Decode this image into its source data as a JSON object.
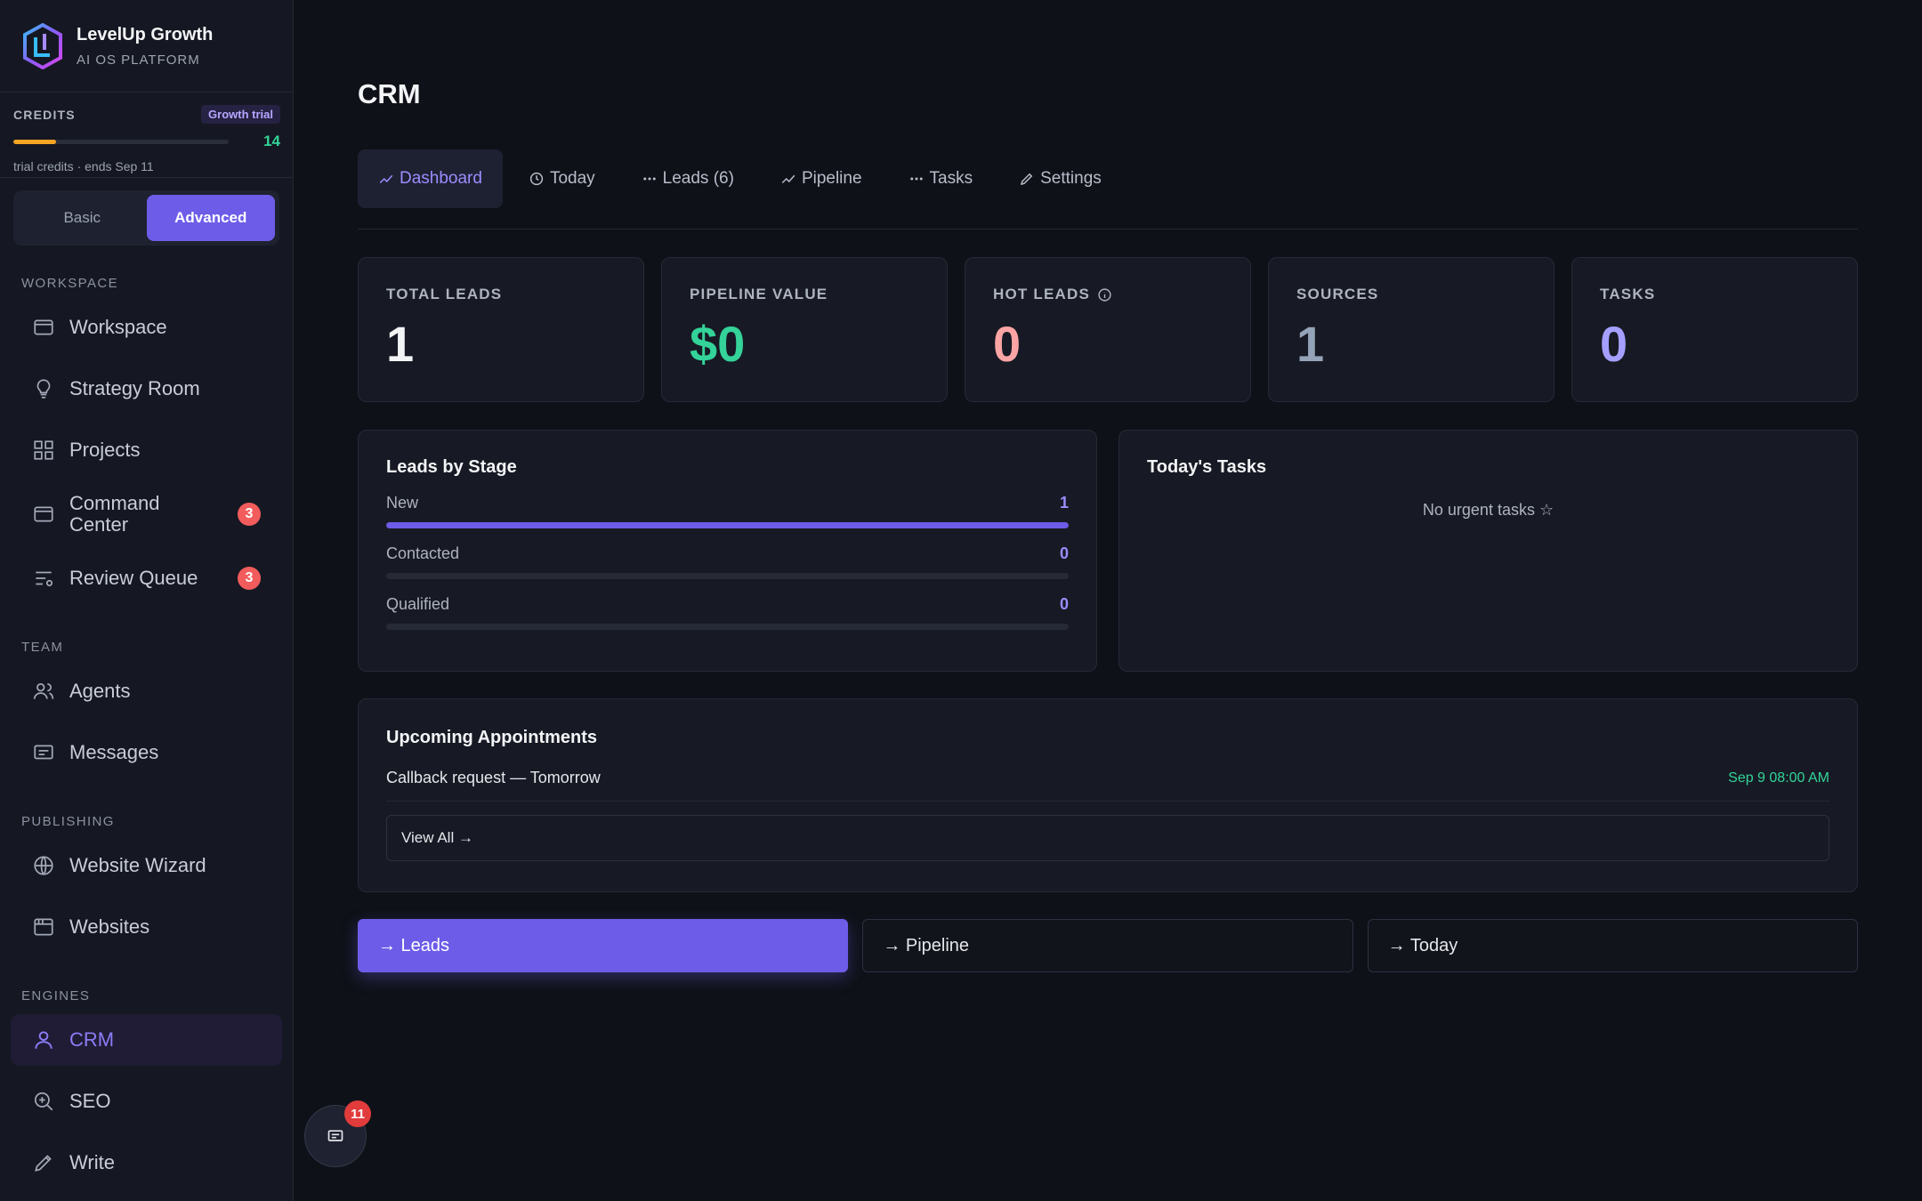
{
  "brand": {
    "name": "LevelUp Growth",
    "subtitle": "AI OS PLATFORM"
  },
  "credits": {
    "label": "CREDITS",
    "badge": "Growth trial",
    "count": "14",
    "fill_fraction": 0.2,
    "note": "trial credits · ends Sep 11"
  },
  "mode": {
    "basic": "Basic",
    "advanced": "Advanced",
    "selected": "Advanced"
  },
  "sidebar": {
    "workspace_label": "WORKSPACE",
    "workspace": [
      {
        "label": "Workspace",
        "icon": "window-icon"
      },
      {
        "label": "Strategy Room",
        "icon": "lightbulb-icon"
      },
      {
        "label": "Projects",
        "icon": "grid-icon"
      },
      {
        "label": "Command Center",
        "icon": "window-icon",
        "badge": "3"
      },
      {
        "label": "Review Queue",
        "icon": "list-filter-icon",
        "badge": "3"
      }
    ],
    "team_label": "TEAM",
    "team": [
      {
        "label": "Agents",
        "icon": "users-icon"
      },
      {
        "label": "Messages",
        "icon": "message-icon"
      }
    ],
    "publishing_label": "PUBLISHING",
    "publishing": [
      {
        "label": "Website Wizard",
        "icon": "globe-icon"
      },
      {
        "label": "Websites",
        "icon": "browser-icon"
      }
    ],
    "engines_label": "ENGINES",
    "engines": [
      {
        "label": "CRM",
        "icon": "user-icon",
        "active": true
      },
      {
        "label": "SEO",
        "icon": "search-plus-icon"
      },
      {
        "label": "Write",
        "icon": "pencil-icon"
      }
    ]
  },
  "page": {
    "title": "CRM"
  },
  "tabs": [
    {
      "label": "Dashboard",
      "icon": "trend-icon"
    },
    {
      "label": "Today",
      "icon": "clock-icon"
    },
    {
      "label": "Leads (6)",
      "icon": "dots-icon"
    },
    {
      "label": "Pipeline",
      "icon": "trend-icon"
    },
    {
      "label": "Tasks",
      "icon": "dots-icon"
    },
    {
      "label": "Settings",
      "icon": "pencil-icon"
    }
  ],
  "stats": [
    {
      "label": "TOTAL LEADS",
      "value": "1",
      "color": "#f3f4f6"
    },
    {
      "label": "PIPELINE VALUE",
      "value": "$0",
      "color": "#34d399"
    },
    {
      "label": "HOT LEADS",
      "value": "0",
      "color": "#fca5a5"
    },
    {
      "label": "SOURCES",
      "value": "1",
      "color": "#94a3b8"
    },
    {
      "label": "TASKS",
      "value": "0",
      "color": "#a5a0ff"
    }
  ],
  "leads_by_stage": {
    "title": "Leads by Stage",
    "stages": [
      {
        "name": "New",
        "count": "1",
        "fraction": 1
      },
      {
        "name": "Contacted",
        "count": "0",
        "fraction": 0
      },
      {
        "name": "Qualified",
        "count": "0",
        "fraction": 0
      }
    ]
  },
  "todays_tasks": {
    "title": "Today's Tasks",
    "empty": "No urgent tasks ☆"
  },
  "appointments": {
    "title": "Upcoming Appointments",
    "items": [
      {
        "title": "Callback request — Tomorrow",
        "time": "Sep 9 08:00 AM"
      }
    ],
    "view_all": "View All →"
  },
  "actions": {
    "leads": "→ Leads",
    "pipeline": "→ Pipeline",
    "today": "→ Today"
  },
  "chat": {
    "badge": "11"
  },
  "colors": {
    "accent": "#6d5ce8",
    "success": "#34d399",
    "danger": "#f25c5c"
  }
}
